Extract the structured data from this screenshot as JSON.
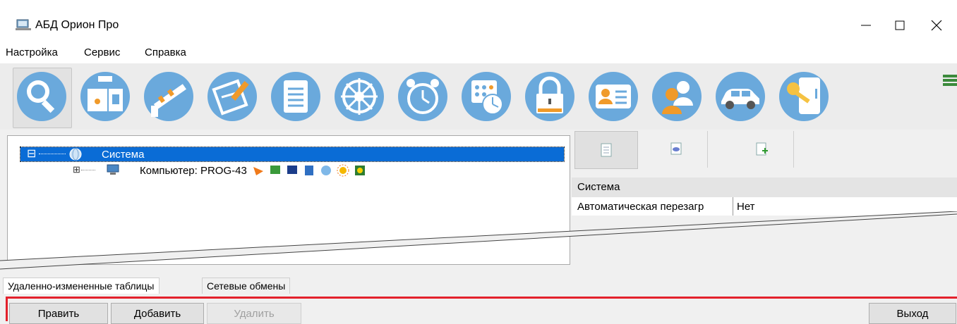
{
  "window": {
    "title": "АБД Орион Про",
    "controls": {
      "minimize": "—",
      "maximize": "☐",
      "close": "✕"
    }
  },
  "menu": {
    "items": [
      "Настройка",
      "Сервис",
      "Справка"
    ]
  },
  "toolbar": {
    "buttons": [
      "search-icon",
      "devices-icon",
      "barrier-icon",
      "floor-plan-icon",
      "document-icon",
      "steering-wheel-icon",
      "alarm-clock-icon",
      "schedule-icon",
      "padlock-icon",
      "id-card-icon",
      "people-icon",
      "car-icon",
      "key-icon"
    ],
    "selected": "search-icon"
  },
  "tree": {
    "root": {
      "label": "Система",
      "expander": "⊟"
    },
    "child": {
      "label": "Компьютер: PROG-43",
      "expander": "⊞"
    }
  },
  "right_panel": {
    "tabs": [
      "page-icon",
      "note-icon",
      "add-page-icon"
    ],
    "section_title": "Система",
    "property": {
      "name": "Автоматическая перезагр",
      "value": "Нет"
    }
  },
  "bottom_tabs": [
    "Удаленно-измененные таблицы",
    "Сетевые обмены"
  ],
  "actions": {
    "edit": "Править",
    "add": "Добавить",
    "delete": "Удалить",
    "exit": "Выход"
  },
  "colors": {
    "selection": "#0a6cd6",
    "toolbar_circle": "#6aa9dc",
    "highlight_border": "#e3212c"
  }
}
